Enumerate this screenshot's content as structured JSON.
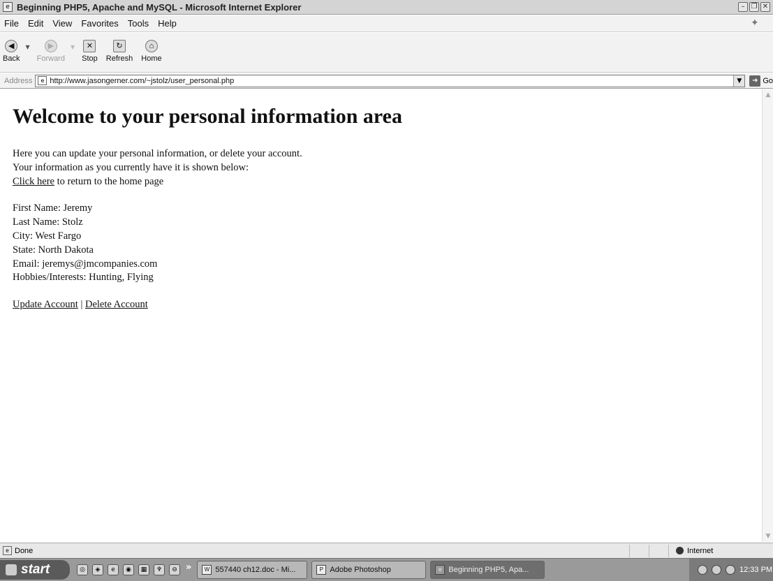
{
  "window": {
    "title": "Beginning PHP5, Apache and MySQL - Microsoft Internet Explorer"
  },
  "menu": {
    "items": [
      "File",
      "Edit",
      "View",
      "Favorites",
      "Tools",
      "Help"
    ]
  },
  "toolbar": {
    "back": "Back",
    "forward": "Forward",
    "stop": "Stop",
    "refresh": "Refresh",
    "home": "Home"
  },
  "address": {
    "label": "Address",
    "url": "http://www.jasongerner.com/~jstolz/user_personal.php",
    "go": "Go"
  },
  "page": {
    "heading": "Welcome to your personal information area",
    "intro_line1": "Here you can update your personal information, or delete your account.",
    "intro_line2": "Your information as you currently have it is shown below:",
    "home_link": "Click here",
    "home_link_suffix": " to return to the home page",
    "fields": [
      "First Name: Jeremy",
      "Last Name: Stolz",
      "City: West Fargo",
      "State: North Dakota",
      "Email: jeremys@jmcompanies.com",
      "Hobbies/Interests: Hunting, Flying"
    ],
    "update_link": "Update Account",
    "separator": " | ",
    "delete_link": "Delete Account"
  },
  "status": {
    "text": "Done",
    "zone": "Internet"
  },
  "taskbar": {
    "start": "start",
    "chevron": "»",
    "tasks": [
      "557440 ch12.doc - Mi...",
      "Adobe Photoshop",
      "Beginning PHP5, Apa..."
    ],
    "clock": "12:33 PM"
  },
  "icons": {
    "back": "back-arrow-icon",
    "forward": "forward-arrow-icon",
    "stop": "stop-icon",
    "refresh": "refresh-icon",
    "home": "home-icon"
  }
}
